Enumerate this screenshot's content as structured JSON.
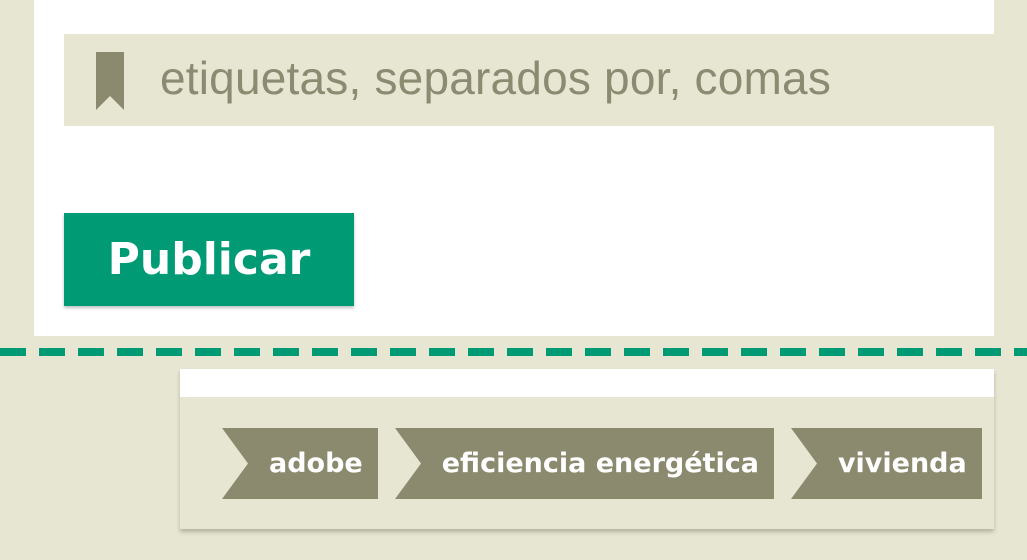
{
  "tags_field": {
    "placeholder": "etiquetas, separados por, comas",
    "icon": "bookmark-icon"
  },
  "publish_button": {
    "label": "Publicar"
  },
  "tags": [
    "adobe",
    "eficiencia energética",
    "vivienda"
  ],
  "colors": {
    "background": "#e7e6d2",
    "accent_green": "#009a74",
    "tag_fill": "#8b8a6f",
    "placeholder_text": "#8b8b72"
  }
}
